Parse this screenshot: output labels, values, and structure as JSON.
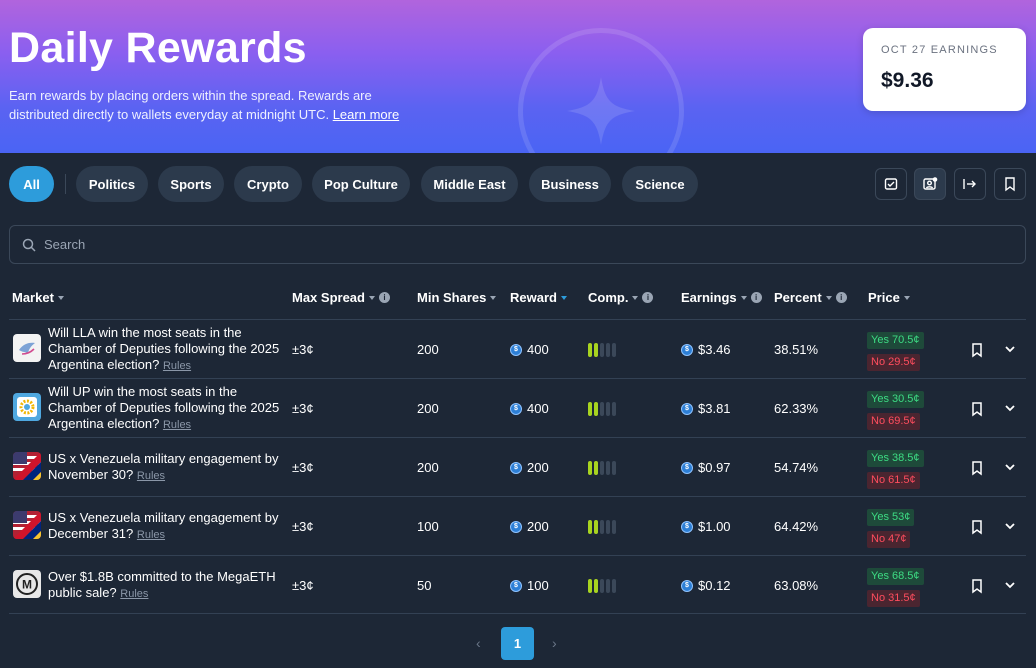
{
  "hero": {
    "title": "Daily Rewards",
    "description": "Earn rewards by placing orders within the spread. Rewards are distributed directly to wallets everyday at midnight UTC.",
    "learn_more": "Learn more",
    "earnings_label": "OCT 27 EARNINGS",
    "earnings_value": "$9.36"
  },
  "filters": [
    "All",
    "Politics",
    "Sports",
    "Crypto",
    "Pop Culture",
    "Middle East",
    "Business",
    "Science"
  ],
  "active_filter": "All",
  "toolbar_icons": [
    "checklist-icon",
    "user-gear-icon",
    "logout-icon",
    "bookmark-icon"
  ],
  "search": {
    "placeholder": "Search"
  },
  "columns": {
    "market": "Market",
    "max_spread": "Max Spread",
    "min_shares": "Min Shares",
    "reward": "Reward",
    "comp": "Comp.",
    "earnings": "Earnings",
    "percent": "Percent",
    "price": "Price"
  },
  "rows": [
    {
      "title": "Will LLA win the most seats in the Chamber of Deputies following the 2025 Argentina election?",
      "rules": "Rules",
      "icon": "dove-icon",
      "max_spread": "±3¢",
      "min_shares": "200",
      "reward": "400",
      "comp_level": 2,
      "earnings": "$3.46",
      "percent": "38.51%",
      "yes": "Yes 70.5¢",
      "no": "No 29.5¢"
    },
    {
      "title": "Will UP win the most seats in the Chamber of Deputies following the 2025 Argentina election?",
      "rules": "Rules",
      "icon": "sun-badge-icon",
      "max_spread": "±3¢",
      "min_shares": "200",
      "reward": "400",
      "comp_level": 2,
      "earnings": "$3.81",
      "percent": "62.33%",
      "yes": "Yes 30.5¢",
      "no": "No 69.5¢"
    },
    {
      "title": "US x Venezuela military engagement by November 30?",
      "rules": "Rules",
      "icon": "flags-icon",
      "max_spread": "±3¢",
      "min_shares": "200",
      "reward": "200",
      "comp_level": 2,
      "earnings": "$0.97",
      "percent": "54.74%",
      "yes": "Yes 38.5¢",
      "no": "No 61.5¢"
    },
    {
      "title": "US x Venezuela military engagement by December 31?",
      "rules": "Rules",
      "icon": "flags-icon",
      "max_spread": "±3¢",
      "min_shares": "100",
      "reward": "200",
      "comp_level": 2,
      "earnings": "$1.00",
      "percent": "64.42%",
      "yes": "Yes 53¢",
      "no": "No 47¢"
    },
    {
      "title": "Over $1.8B committed to the MegaETH public sale?",
      "rules": "Rules",
      "icon": "megaeth-icon",
      "max_spread": "±3¢",
      "min_shares": "50",
      "reward": "100",
      "comp_level": 2,
      "earnings": "$0.12",
      "percent": "63.08%",
      "yes": "Yes 68.5¢",
      "no": "No 31.5¢"
    }
  ],
  "pagination": {
    "current": "1",
    "prev": "‹",
    "next": "›"
  },
  "colors": {
    "accent": "#2d9cdb",
    "yes": "#3ddc84",
    "no": "#ff4d5e",
    "comp_on": "#a8d420",
    "background": "#1d2736"
  }
}
